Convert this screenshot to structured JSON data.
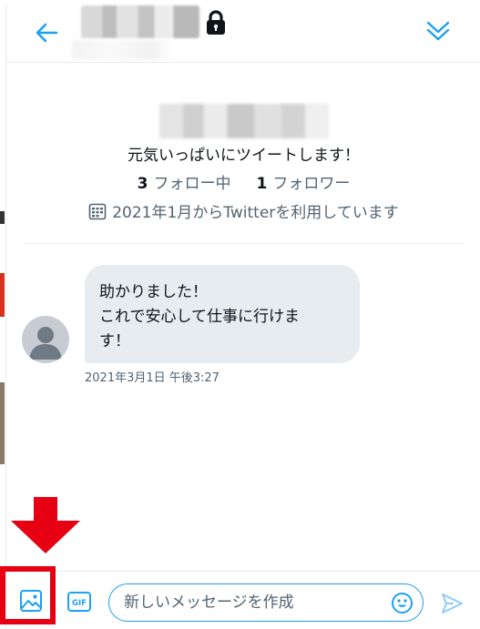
{
  "header": {
    "back_icon": "arrow-left-icon",
    "lock_icon": "lock-icon",
    "collapse_icon": "double-chevron-down-icon"
  },
  "profile": {
    "bio": "元気いっぱいにツイートします！",
    "following_count": "3",
    "following_label": "フォロー中",
    "followers_count": "1",
    "followers_label": "フォロワー",
    "joined_text": "2021年1月からTwitterを利用しています"
  },
  "message": {
    "lines": [
      "助かりました！",
      "これで安心して仕事に行けま",
      "す！"
    ],
    "timestamp": "2021年3月1日 午後3:27"
  },
  "composer": {
    "gif_label": "GIF",
    "placeholder": "新しいメッセージを作成",
    "media_icon": "image-icon",
    "emoji_icon": "emoji-icon",
    "send_icon": "send-icon"
  },
  "colors": {
    "accent": "#1da1f2",
    "annotation": "#e60012",
    "bubble": "#e6ecf0",
    "secondary_text": "#536471"
  }
}
